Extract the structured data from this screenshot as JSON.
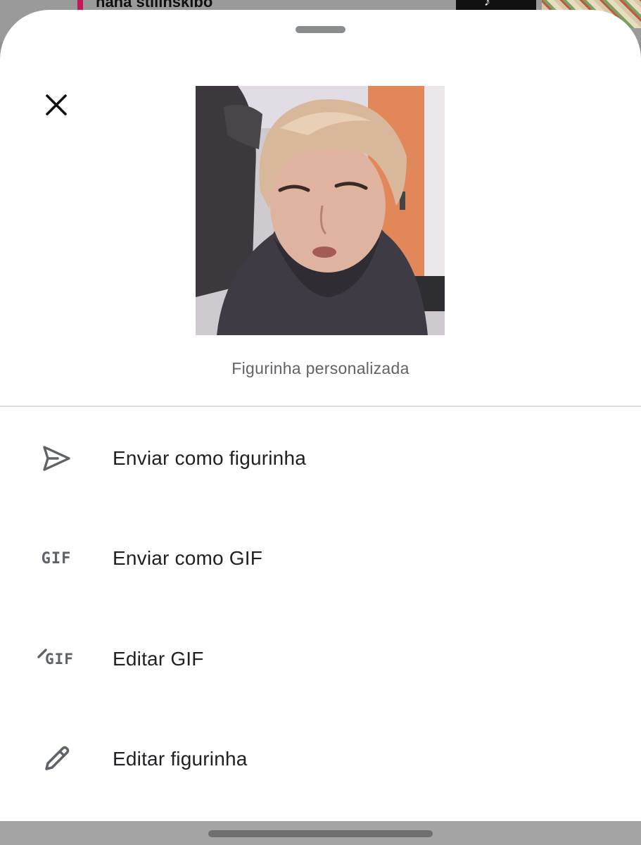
{
  "background": {
    "partial_text": "nana   stilinskibo"
  },
  "sheet": {
    "caption": "Figurinha personalizada",
    "close_icon": "close-icon",
    "menu": [
      {
        "label": "Enviar como figurinha",
        "icon": "send-icon"
      },
      {
        "label": "Enviar como GIF",
        "icon": "gif-icon",
        "icon_text": "GIF"
      },
      {
        "label": "Editar GIF",
        "icon": "edit-gif-icon",
        "icon_text": "GIF"
      },
      {
        "label": "Editar figurinha",
        "icon": "pencil-icon"
      }
    ]
  },
  "colors": {
    "sheet_bg": "#ffffff",
    "text_primary": "#202124",
    "text_secondary": "#5f6368",
    "icon": "#5f6368",
    "divider": "#dadce0",
    "handle": "#8a8d90"
  }
}
